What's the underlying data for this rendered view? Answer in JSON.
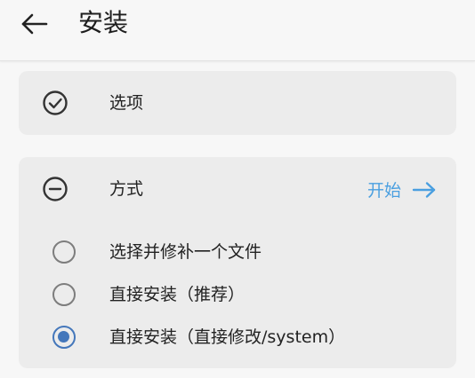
{
  "header": {
    "title": "安装"
  },
  "options_card": {
    "label": "选项"
  },
  "method_card": {
    "label": "方式",
    "start_label": "开始",
    "choices": [
      {
        "label": "选择并修补一个文件",
        "selected": false
      },
      {
        "label": "直接安装（推荐）",
        "selected": false
      },
      {
        "label": "直接安装（直接修改/system）",
        "selected": true
      }
    ]
  },
  "colors": {
    "accent": "#4a9fe0",
    "radio_selected": "#4477bb",
    "card": "#ececec"
  }
}
